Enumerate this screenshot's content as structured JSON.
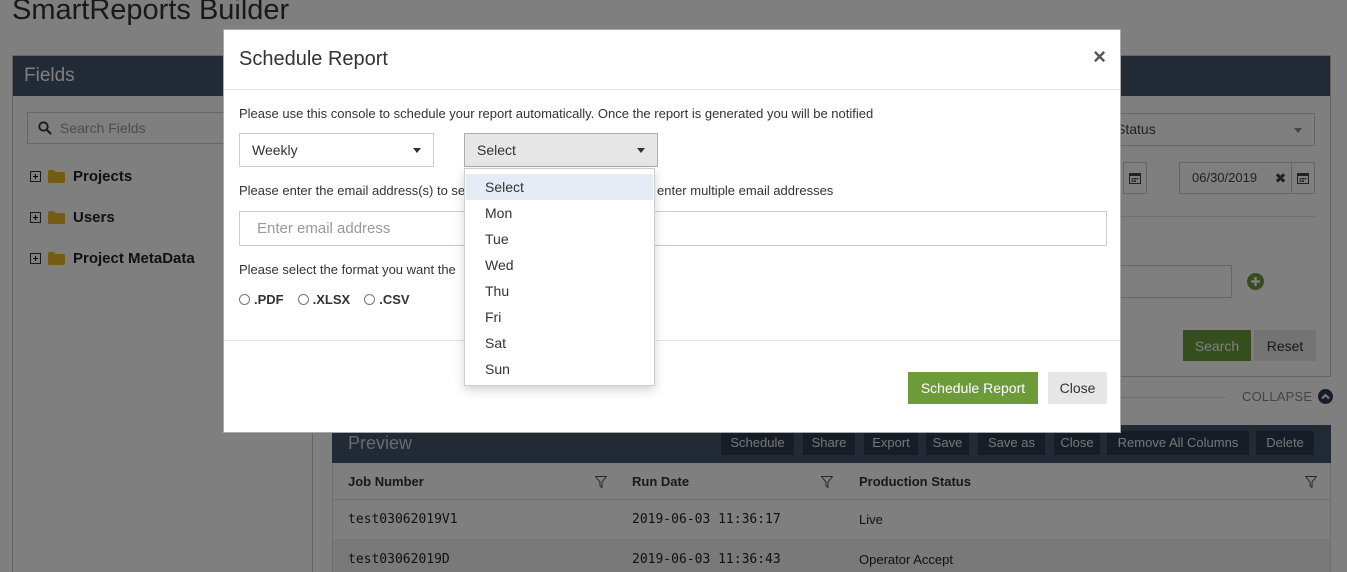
{
  "app": {
    "title": "SmartReports Builder"
  },
  "fields": {
    "header": "Fields",
    "search_placeholder": "Search Fields",
    "tree": [
      {
        "label": "Projects"
      },
      {
        "label": "Users"
      },
      {
        "label": "Project MetaData"
      }
    ]
  },
  "filters": {
    "status_select": "Status",
    "end_date": "06/30/2019",
    "search_label": "Search",
    "reset_label": "Reset",
    "collapse_label": "COLLAPSE"
  },
  "preview": {
    "title": "Preview",
    "toolbar": [
      {
        "label": "Schedule"
      },
      {
        "label": "Share"
      },
      {
        "label": "Export"
      },
      {
        "label": "Save"
      },
      {
        "label": "Save as"
      },
      {
        "label": "Close"
      },
      {
        "label": "Remove All Columns"
      },
      {
        "label": "Delete"
      }
    ],
    "columns": [
      "Job Number",
      "Run Date",
      "Production Status"
    ],
    "rows": [
      [
        "test03062019V1",
        "2019-06-03 11:36:17",
        "Live"
      ],
      [
        "test03062019D",
        "2019-06-03 11:36:43",
        "Operator Accept"
      ]
    ]
  },
  "modal": {
    "title": "Schedule Report",
    "close_glyph": "×",
    "intro": "Please use this console to schedule your report automatically. Once the report is generated you will be notified",
    "frequency_value": "Weekly",
    "day_value": "Select",
    "email_prompt_left": "Please enter the email address(s) to se",
    "email_prompt_right": "enter multiple email addresses",
    "email_placeholder": "Enter email address",
    "format_prompt": "Please select the format you want the",
    "formats": [
      ".PDF",
      ".XLSX",
      ".CSV"
    ],
    "schedule_label": "Schedule Report",
    "close_label": "Close"
  },
  "day_dropdown": {
    "options": [
      "Select",
      "Mon",
      "Tue",
      "Wed",
      "Thu",
      "Fri",
      "Sat",
      "Sun"
    ],
    "highlighted": "Select"
  },
  "colors": {
    "header_bg": "#44546a",
    "primary_green": "#6d9b3a",
    "toolbar_btn": "#2e3b4d"
  }
}
